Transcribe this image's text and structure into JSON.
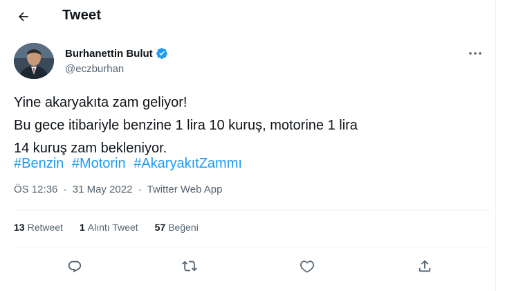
{
  "header": {
    "title": "Tweet",
    "back_icon": "arrow-left-icon"
  },
  "author": {
    "name": "Burhanettin Bulut",
    "handle": "@eczburhan",
    "verified_icon": "verified-badge-icon",
    "avatar": "avatar-photo"
  },
  "tweet": {
    "lines": [
      "Yine akaryakıta zam geliyor!",
      "Bu gece itibariyle benzine 1 lira 10 kuruş, motorine 1 lira",
      "14 kuruş zam bekleniyor."
    ],
    "hashtags": [
      "#Benzin",
      "#Motorin",
      "#AkaryakıtZammı"
    ]
  },
  "meta": {
    "time": "ÖS 12:36",
    "separator": "·",
    "date": "31 May 2022",
    "source": "Twitter Web App"
  },
  "stats": [
    {
      "count": "13",
      "label": "Retweet"
    },
    {
      "count": "1",
      "label": "Alıntı Tweet"
    },
    {
      "count": "57",
      "label": "Beğeni"
    }
  ],
  "actions": [
    "reply-icon",
    "retweet-icon",
    "like-icon",
    "share-icon"
  ],
  "colors": {
    "accent": "#1d9bf0",
    "text": "#0f1419",
    "secondary": "#536471",
    "divider": "#eff3f4"
  }
}
